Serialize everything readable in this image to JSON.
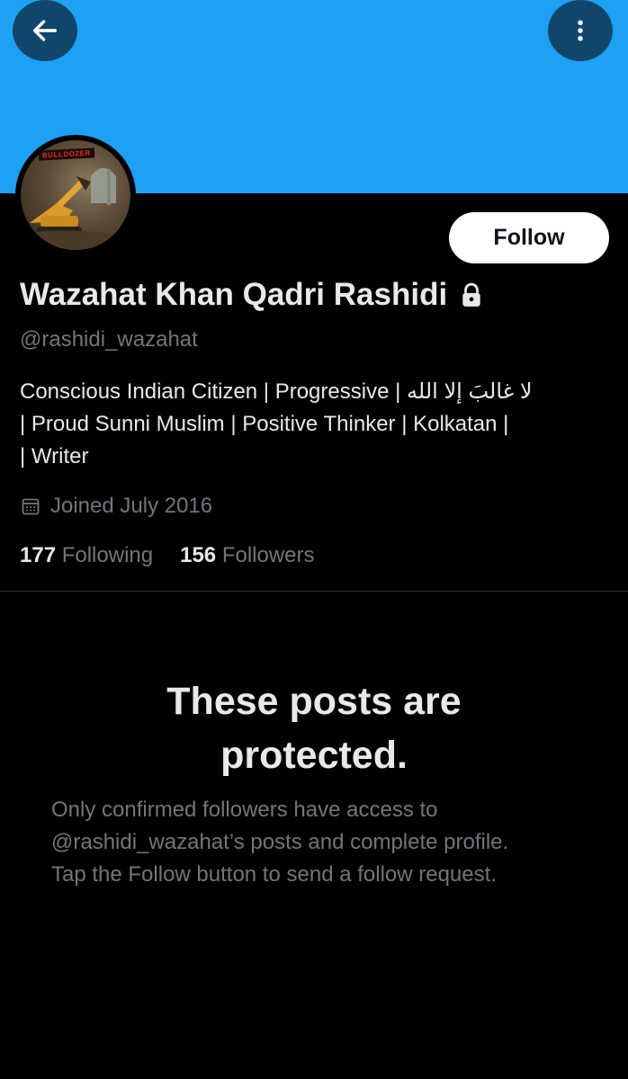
{
  "header": {
    "back_icon": "arrow-left-icon",
    "more_icon": "more-vertical-icon",
    "banner_color": "#1da1f2"
  },
  "profile": {
    "avatar_text": "BULLDOZER",
    "follow_label": "Follow",
    "display_name": "Wazahat Khan Qadri Rashidi",
    "lock_icon": "lock-icon",
    "handle": "@rashidi_wazahat",
    "bio_lines": [
      "Conscious Indian Citizen | Progressive | لا غالبَ إلا الله",
      "| Proud Sunni Muslim | Positive Thinker | Kolkatan |",
      "| Writer"
    ],
    "joined_icon": "calendar-icon",
    "joined": "Joined July 2016",
    "following_count": "177",
    "following_label": "Following",
    "followers_count": "156",
    "followers_label": "Followers"
  },
  "protected": {
    "title_line1": "These posts are",
    "title_line2": "protected.",
    "body_lines": [
      "Only confirmed followers have access to",
      "@rashidi_wazahat’s posts and complete profile.",
      "Tap the Follow button to send a follow request."
    ]
  }
}
